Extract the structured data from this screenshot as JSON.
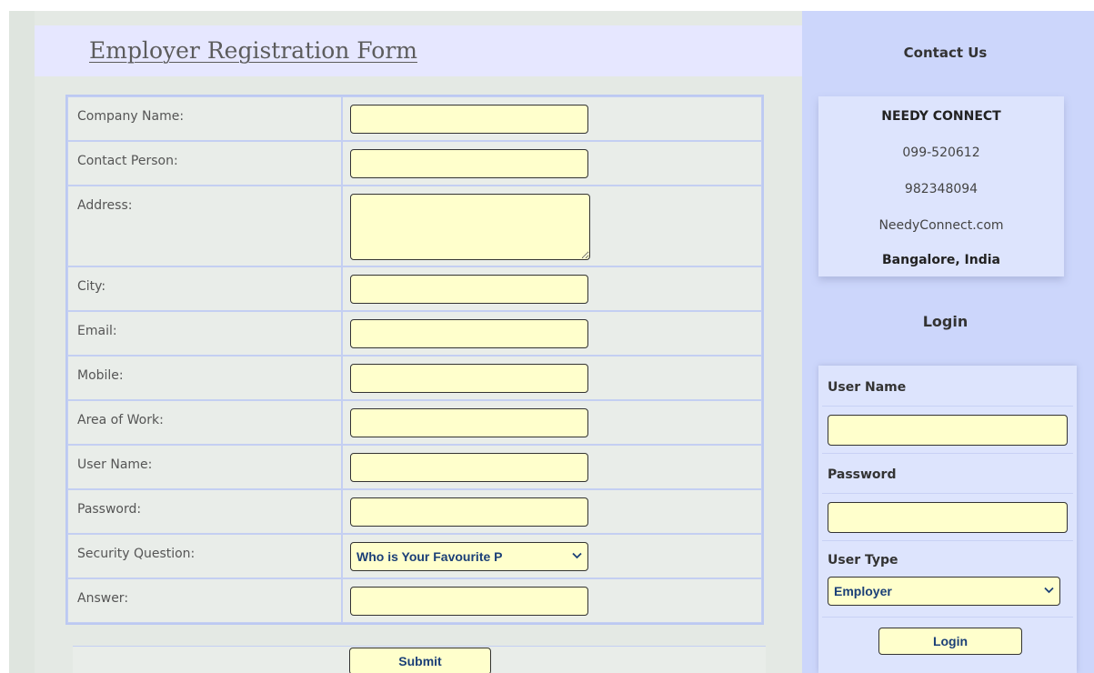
{
  "form": {
    "title": "Employer Registration Form",
    "fields": {
      "company_name": {
        "label": "Company Name:",
        "value": ""
      },
      "contact_person": {
        "label": "Contact Person:",
        "value": ""
      },
      "address": {
        "label": "Address:",
        "value": ""
      },
      "city": {
        "label": "City:",
        "value": ""
      },
      "email": {
        "label": "Email:",
        "value": ""
      },
      "mobile": {
        "label": "Mobile:",
        "value": ""
      },
      "area_of_work": {
        "label": "Area of Work:",
        "value": ""
      },
      "user_name": {
        "label": "User Name:",
        "value": ""
      },
      "password": {
        "label": "Password:",
        "value": ""
      },
      "security_question": {
        "label": "Security Question:",
        "selected": "Who is Your Favourite P"
      },
      "answer": {
        "label": "Answer:",
        "value": ""
      }
    },
    "submit_label": "Submit"
  },
  "contact": {
    "heading": "Contact Us",
    "company": "NEEDY CONNECT",
    "phone1": "099-520612",
    "phone2": "982348094",
    "website": "NeedyConnect.com",
    "location": "Bangalore, India"
  },
  "login": {
    "heading": "Login",
    "username_label": "User Name",
    "username_value": "",
    "password_label": "Password",
    "password_value": "",
    "usertype_label": "User Type",
    "usertype_selected": "Employer",
    "button_label": "Login"
  },
  "icons": {
    "dropdown": "chevron-down-icon"
  },
  "colors": {
    "input_background": "#ffffcc",
    "sidebar_background": "#ccd6fb",
    "title_bar_background": "#e6e7ff",
    "select_text": "#1b3f77"
  }
}
